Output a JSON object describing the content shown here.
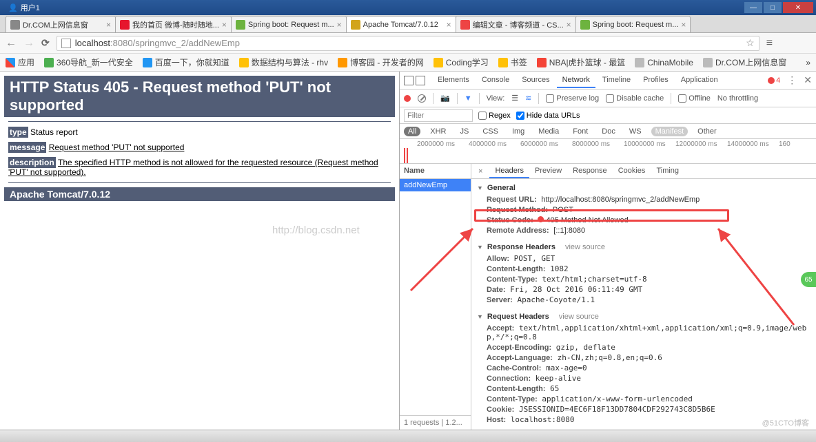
{
  "window": {
    "user_label": "用户1",
    "min": "—",
    "max": "□",
    "close": "✕"
  },
  "tabs": [
    {
      "icon": "#888",
      "title": "Dr.COM上网信息窗"
    },
    {
      "icon": "#e6162d",
      "title": "我的首页 微博-随时随地..."
    },
    {
      "icon": "#6db33f",
      "title": "Spring boot: Request m..."
    },
    {
      "icon": "#d2a41c",
      "title": "Apache Tomcat/7.0.12",
      "active": true
    },
    {
      "icon": "#e44",
      "title": "编辑文章 - 博客频道 - CS..."
    },
    {
      "icon": "#6db33f",
      "title": "Spring boot: Request m..."
    }
  ],
  "address": {
    "host": "localhost",
    "port_path": ":8080/springmvc_2/addNewEmp"
  },
  "bookmarks": {
    "apps": "应用",
    "items": [
      {
        "cls": "green",
        "label": "360导航_新一代安全"
      },
      {
        "cls": "blue",
        "label": "百度一下，你就知道"
      },
      {
        "cls": "yellow",
        "label": "数据结构与算法 - rhv"
      },
      {
        "cls": "orange",
        "label": "博客园 - 开发者的网"
      },
      {
        "cls": "yellow",
        "label": "Coding学习"
      },
      {
        "cls": "yellow",
        "label": "书签"
      },
      {
        "cls": "red",
        "label": "NBA|虎扑篮球 - 最篮"
      },
      {
        "cls": "gray",
        "label": "ChinaMobile"
      },
      {
        "cls": "gray",
        "label": "Dr.COM上网信息窗"
      }
    ]
  },
  "error_page": {
    "h1": "HTTP Status 405 - Request method 'PUT' not supported",
    "type_label": "type",
    "type_value": "Status report",
    "message_label": "message",
    "message_value": "Request method 'PUT' not supported",
    "description_label": "description",
    "description_value": "The specified HTTP method is not allowed for the requested resource (Request method 'PUT' not supported).",
    "footer": "Apache Tomcat/7.0.12",
    "watermark": "http://blog.csdn.net"
  },
  "devtools": {
    "tabs": [
      "Elements",
      "Console",
      "Sources",
      "Network",
      "Timeline",
      "Profiles",
      "Application"
    ],
    "active_tab": "Network",
    "error_count": "4",
    "toolbar": {
      "view": "View:",
      "preserve": "Preserve log",
      "disable": "Disable cache",
      "offline": "Offline",
      "throttle": "No throttling"
    },
    "filter": {
      "placeholder": "Filter",
      "regex": "Regex",
      "hide": "Hide data URLs"
    },
    "types": [
      "All",
      "XHR",
      "JS",
      "CSS",
      "Img",
      "Media",
      "Font",
      "Doc",
      "WS",
      "Manifest",
      "Other"
    ],
    "timeline_ticks": [
      "2000000 ms",
      "4000000 ms",
      "6000000 ms",
      "8000000 ms",
      "10000000 ms",
      "12000000 ms",
      "14000000 ms",
      "160"
    ],
    "names": {
      "header": "Name",
      "item": "addNewEmp",
      "footer": "1 requests | 1.2..."
    },
    "detail_tabs": [
      "Headers",
      "Preview",
      "Response",
      "Cookies",
      "Timing"
    ],
    "general": {
      "title": "General",
      "request_url_k": "Request URL:",
      "request_url_v": "http://localhost:8080/springmvc_2/addNewEmp",
      "request_method_k": "Request Method:",
      "request_method_v": "POST",
      "status_code_k": "Status Code:",
      "status_code_v": "405 Method Not Allowed",
      "remote_k": "Remote Address:",
      "remote_v": "[::1]:8080"
    },
    "response_headers": {
      "title": "Response Headers",
      "view": "view source",
      "items": [
        {
          "k": "Allow:",
          "v": "POST, GET"
        },
        {
          "k": "Content-Length:",
          "v": "1082"
        },
        {
          "k": "Content-Type:",
          "v": "text/html;charset=utf-8"
        },
        {
          "k": "Date:",
          "v": "Fri, 28 Oct 2016 06:11:49 GMT"
        },
        {
          "k": "Server:",
          "v": "Apache-Coyote/1.1"
        }
      ]
    },
    "request_headers": {
      "title": "Request Headers",
      "view": "view source",
      "items": [
        {
          "k": "Accept:",
          "v": "text/html,application/xhtml+xml,application/xml;q=0.9,image/webp,*/*;q=0.8"
        },
        {
          "k": "Accept-Encoding:",
          "v": "gzip, deflate"
        },
        {
          "k": "Accept-Language:",
          "v": "zh-CN,zh;q=0.8,en;q=0.6"
        },
        {
          "k": "Cache-Control:",
          "v": "max-age=0"
        },
        {
          "k": "Connection:",
          "v": "keep-alive"
        },
        {
          "k": "Content-Length:",
          "v": "65"
        },
        {
          "k": "Content-Type:",
          "v": "application/x-www-form-urlencoded"
        },
        {
          "k": "Cookie:",
          "v": "JSESSIONID=4EC6F18F13DD7804CDF292743C8D5B6E"
        },
        {
          "k": "Host:",
          "v": "localhost:8080"
        }
      ]
    }
  },
  "badge": "65",
  "cto": "@51CTO博客"
}
